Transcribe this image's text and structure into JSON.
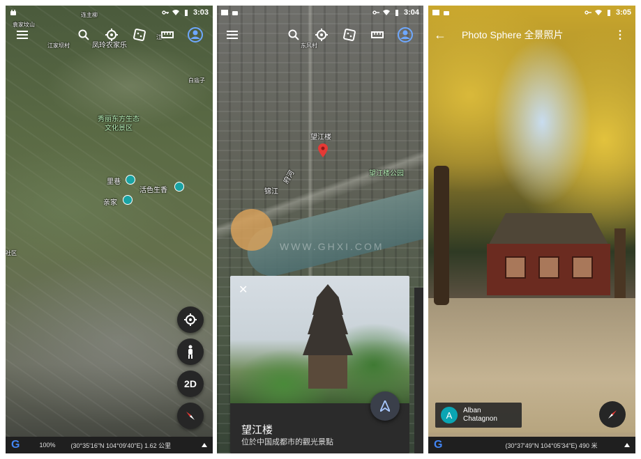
{
  "screens": [
    {
      "status": {
        "time": "3:03"
      },
      "toolbar": {
        "icons": [
          "menu-icon",
          "search-icon",
          "voyager-icon",
          "dice-icon",
          "measure-icon",
          "account-icon"
        ]
      },
      "labels": [
        "袁家坟山",
        "连主柳",
        "江家坝村",
        "江",
        "凤玲农家乐",
        "白庙子",
        "秀丽东方生态",
        "文化景区",
        "里巷",
        "活色生香",
        "亲家",
        "社区"
      ],
      "fabs": {
        "locate": "locate-icon",
        "pegman": "pegman-icon",
        "mode": "2D",
        "compass": "compass-icon"
      },
      "bottom": {
        "zoom": "100%",
        "coords": "(30°35'16\"N 104°09'40\"E) 1.62 公里"
      }
    },
    {
      "status": {
        "time": "3:04"
      },
      "labels": [
        "东风村",
        "望江楼",
        "望江楼公园",
        "锦江",
        "府河"
      ],
      "watermark": "WWW.GHXI.COM",
      "card": {
        "title": "望江楼",
        "subtitle": "位於中国成都市的觀光景點"
      }
    },
    {
      "status": {
        "time": "3:05"
      },
      "header": {
        "title": "Photo Sphere 全景照片"
      },
      "author": {
        "initial": "A",
        "name_line1": "Alban",
        "name_line2": "Chatagnon"
      },
      "bottom": {
        "coords": "(30°37'49\"N 104°05'34\"E) 490 米"
      }
    }
  ],
  "colors": {
    "bar": "#1f1f1f",
    "fab": "#262626",
    "pin": "#e53935",
    "teal": "#1aa3a3"
  }
}
